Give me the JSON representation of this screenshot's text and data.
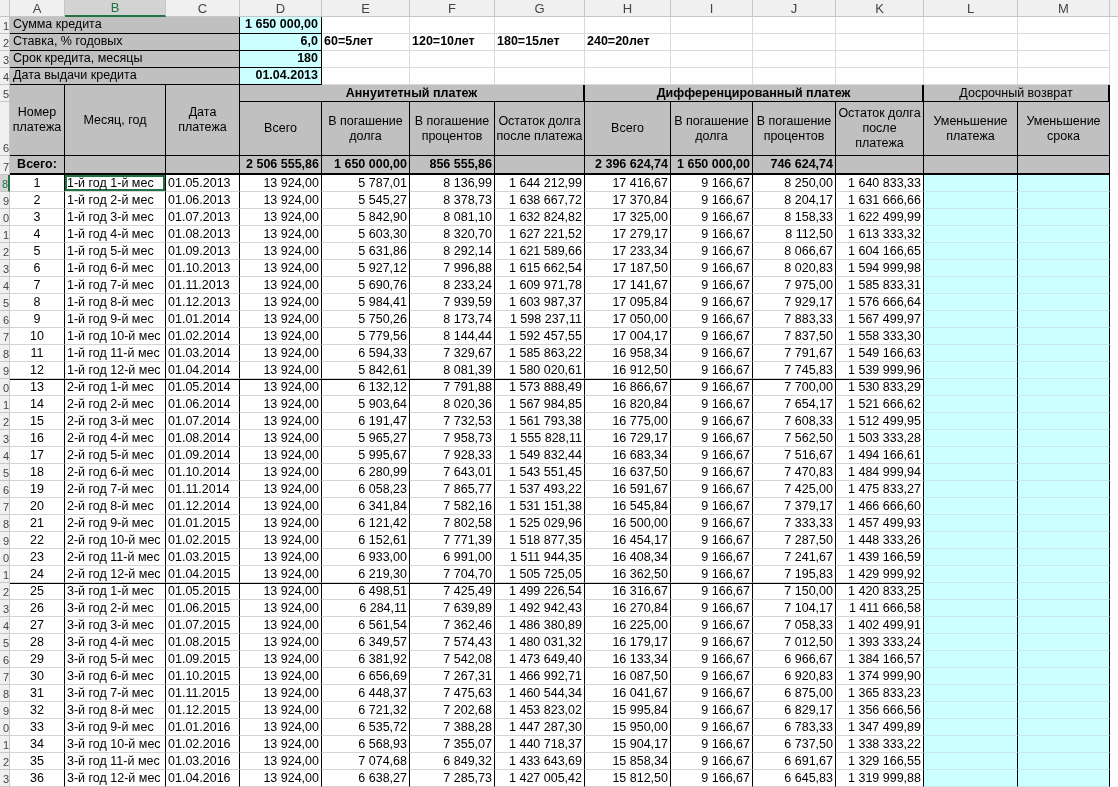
{
  "column_headers": [
    {
      "label": "A",
      "selected": false
    },
    {
      "label": "B",
      "selected": true
    },
    {
      "label": "C",
      "selected": false
    },
    {
      "label": "D",
      "selected": false
    },
    {
      "label": "E",
      "selected": false
    },
    {
      "label": "F",
      "selected": false
    },
    {
      "label": "G",
      "selected": false
    },
    {
      "label": "H",
      "selected": false
    },
    {
      "label": "I",
      "selected": false
    },
    {
      "label": "J",
      "selected": false
    },
    {
      "label": "K",
      "selected": false
    },
    {
      "label": "L",
      "selected": false
    },
    {
      "label": "M",
      "selected": false
    }
  ],
  "summary": [
    {
      "row_number": "1",
      "label": "Сумма кредита",
      "value": "1 650 000,00"
    },
    {
      "row_number": "2",
      "label": "Ставка, % годовых",
      "value": "6,0"
    },
    {
      "row_number": "3",
      "label": "Срок кредита, месяцы",
      "value": "180"
    },
    {
      "row_number": "4",
      "label": "Дата выдачи кредита",
      "value": "01.04.2013"
    }
  ],
  "term_notes": [
    "60=5лет",
    "120=10лет",
    "180=15лет",
    "240=20лет"
  ],
  "table": {
    "header_row_numbers": [
      "5",
      "6",
      "7"
    ],
    "fixed_columns": [
      "Номер платежа",
      "Месяц, год",
      "Дата платежа"
    ],
    "totals_label": "Всего:",
    "groups": [
      {
        "title": "Аннуитетный платеж",
        "bold": true,
        "kind": "schedule",
        "columns": [
          "Всего",
          "В погашение долга",
          "В погашение процентов",
          "Остаток долга после платежа"
        ],
        "totals": [
          "2 506 555,86",
          "1 650 000,00",
          "856 555,86"
        ]
      },
      {
        "title": "Дифференцированный платеж",
        "bold": true,
        "kind": "schedule",
        "columns": [
          "Всего",
          "В погашение долга",
          "В погашение процентов",
          "Остаток долга после платежа"
        ],
        "totals": [
          "2 396 624,74",
          "1 650 000,00",
          "746 624,74"
        ]
      },
      {
        "title": "Досрочный возврат",
        "bold": false,
        "kind": "input",
        "columns": [
          "Уменьшение платежа",
          "Уменьшение срока"
        ]
      }
    ],
    "rows": [
      {
        "row_number": "8",
        "selected": true,
        "year_start": false,
        "cells": [
          "1",
          "1-й год 1-й мес",
          "01.05.2013",
          "13 924,00",
          "5 787,01",
          "8 136,99",
          "1 644 212,99",
          "17 416,67",
          "9 166,67",
          "8 250,00",
          "1 640 833,33"
        ]
      },
      {
        "row_number": "9",
        "selected": false,
        "year_start": false,
        "cells": [
          "2",
          "1-й год 2-й мес",
          "01.06.2013",
          "13 924,00",
          "5 545,27",
          "8 378,73",
          "1 638 667,72",
          "17 370,84",
          "9 166,67",
          "8 204,17",
          "1 631 666,66"
        ]
      },
      {
        "row_number": "0",
        "selected": false,
        "year_start": false,
        "cells": [
          "3",
          "1-й год 3-й мес",
          "01.07.2013",
          "13 924,00",
          "5 842,90",
          "8 081,10",
          "1 632 824,82",
          "17 325,00",
          "9 166,67",
          "8 158,33",
          "1 622 499,99"
        ]
      },
      {
        "row_number": "1",
        "selected": false,
        "year_start": false,
        "cells": [
          "4",
          "1-й год 4-й мес",
          "01.08.2013",
          "13 924,00",
          "5 603,30",
          "8 320,70",
          "1 627 221,52",
          "17 279,17",
          "9 166,67",
          "8 112,50",
          "1 613 333,32"
        ]
      },
      {
        "row_number": "2",
        "selected": false,
        "year_start": false,
        "cells": [
          "5",
          "1-й год 5-й мес",
          "01.09.2013",
          "13 924,00",
          "5 631,86",
          "8 292,14",
          "1 621 589,66",
          "17 233,34",
          "9 166,67",
          "8 066,67",
          "1 604 166,65"
        ]
      },
      {
        "row_number": "3",
        "selected": false,
        "year_start": false,
        "cells": [
          "6",
          "1-й год 6-й мес",
          "01.10.2013",
          "13 924,00",
          "5 927,12",
          "7 996,88",
          "1 615 662,54",
          "17 187,50",
          "9 166,67",
          "8 020,83",
          "1 594 999,98"
        ]
      },
      {
        "row_number": "4",
        "selected": false,
        "year_start": false,
        "cells": [
          "7",
          "1-й год 7-й мес",
          "01.11.2013",
          "13 924,00",
          "5 690,76",
          "8 233,24",
          "1 609 971,78",
          "17 141,67",
          "9 166,67",
          "7 975,00",
          "1 585 833,31"
        ]
      },
      {
        "row_number": "5",
        "selected": false,
        "year_start": false,
        "cells": [
          "8",
          "1-й год 8-й мес",
          "01.12.2013",
          "13 924,00",
          "5 984,41",
          "7 939,59",
          "1 603 987,37",
          "17 095,84",
          "9 166,67",
          "7 929,17",
          "1 576 666,64"
        ]
      },
      {
        "row_number": "6",
        "selected": false,
        "year_start": false,
        "cells": [
          "9",
          "1-й год 9-й мес",
          "01.01.2014",
          "13 924,00",
          "5 750,26",
          "8 173,74",
          "1 598 237,11",
          "17 050,00",
          "9 166,67",
          "7 883,33",
          "1 567 499,97"
        ]
      },
      {
        "row_number": "7",
        "selected": false,
        "year_start": false,
        "cells": [
          "10",
          "1-й год 10-й мес",
          "01.02.2014",
          "13 924,00",
          "5 779,56",
          "8 144,44",
          "1 592 457,55",
          "17 004,17",
          "9 166,67",
          "7 837,50",
          "1 558 333,30"
        ]
      },
      {
        "row_number": "8",
        "selected": false,
        "year_start": false,
        "cells": [
          "11",
          "1-й год 11-й мес",
          "01.03.2014",
          "13 924,00",
          "6 594,33",
          "7 329,67",
          "1 585 863,22",
          "16 958,34",
          "9 166,67",
          "7 791,67",
          "1 549 166,63"
        ]
      },
      {
        "row_number": "9",
        "selected": false,
        "year_start": false,
        "cells": [
          "12",
          "1-й год 12-й мес",
          "01.04.2014",
          "13 924,00",
          "5 842,61",
          "8 081,39",
          "1 580 020,61",
          "16 912,50",
          "9 166,67",
          "7 745,83",
          "1 539 999,96"
        ]
      },
      {
        "row_number": "0",
        "selected": false,
        "year_start": true,
        "cells": [
          "13",
          "2-й год 1-й мес",
          "01.05.2014",
          "13 924,00",
          "6 132,12",
          "7 791,88",
          "1 573 888,49",
          "16 866,67",
          "9 166,67",
          "7 700,00",
          "1 530 833,29"
        ]
      },
      {
        "row_number": "1",
        "selected": false,
        "year_start": false,
        "cells": [
          "14",
          "2-й год 2-й мес",
          "01.06.2014",
          "13 924,00",
          "5 903,64",
          "8 020,36",
          "1 567 984,85",
          "16 820,84",
          "9 166,67",
          "7 654,17",
          "1 521 666,62"
        ]
      },
      {
        "row_number": "2",
        "selected": false,
        "year_start": false,
        "cells": [
          "15",
          "2-й год 3-й мес",
          "01.07.2014",
          "13 924,00",
          "6 191,47",
          "7 732,53",
          "1 561 793,38",
          "16 775,00",
          "9 166,67",
          "7 608,33",
          "1 512 499,95"
        ]
      },
      {
        "row_number": "3",
        "selected": false,
        "year_start": false,
        "cells": [
          "16",
          "2-й год 4-й мес",
          "01.08.2014",
          "13 924,00",
          "5 965,27",
          "7 958,73",
          "1 555 828,11",
          "16 729,17",
          "9 166,67",
          "7 562,50",
          "1 503 333,28"
        ]
      },
      {
        "row_number": "4",
        "selected": false,
        "year_start": false,
        "cells": [
          "17",
          "2-й год 5-й мес",
          "01.09.2014",
          "13 924,00",
          "5 995,67",
          "7 928,33",
          "1 549 832,44",
          "16 683,34",
          "9 166,67",
          "7 516,67",
          "1 494 166,61"
        ]
      },
      {
        "row_number": "5",
        "selected": false,
        "year_start": false,
        "cells": [
          "18",
          "2-й год 6-й мес",
          "01.10.2014",
          "13 924,00",
          "6 280,99",
          "7 643,01",
          "1 543 551,45",
          "16 637,50",
          "9 166,67",
          "7 470,83",
          "1 484 999,94"
        ]
      },
      {
        "row_number": "6",
        "selected": false,
        "year_start": false,
        "cells": [
          "19",
          "2-й год 7-й мес",
          "01.11.2014",
          "13 924,00",
          "6 058,23",
          "7 865,77",
          "1 537 493,22",
          "16 591,67",
          "9 166,67",
          "7 425,00",
          "1 475 833,27"
        ]
      },
      {
        "row_number": "7",
        "selected": false,
        "year_start": false,
        "cells": [
          "20",
          "2-й год 8-й мес",
          "01.12.2014",
          "13 924,00",
          "6 341,84",
          "7 582,16",
          "1 531 151,38",
          "16 545,84",
          "9 166,67",
          "7 379,17",
          "1 466 666,60"
        ]
      },
      {
        "row_number": "8",
        "selected": false,
        "year_start": false,
        "cells": [
          "21",
          "2-й год 9-й мес",
          "01.01.2015",
          "13 924,00",
          "6 121,42",
          "7 802,58",
          "1 525 029,96",
          "16 500,00",
          "9 166,67",
          "7 333,33",
          "1 457 499,93"
        ]
      },
      {
        "row_number": "9",
        "selected": false,
        "year_start": false,
        "cells": [
          "22",
          "2-й год 10-й мес",
          "01.02.2015",
          "13 924,00",
          "6 152,61",
          "7 771,39",
          "1 518 877,35",
          "16 454,17",
          "9 166,67",
          "7 287,50",
          "1 448 333,26"
        ]
      },
      {
        "row_number": "0",
        "selected": false,
        "year_start": false,
        "cells": [
          "23",
          "2-й год 11-й мес",
          "01.03.2015",
          "13 924,00",
          "6 933,00",
          "6 991,00",
          "1 511 944,35",
          "16 408,34",
          "9 166,67",
          "7 241,67",
          "1 439 166,59"
        ]
      },
      {
        "row_number": "1",
        "selected": false,
        "year_start": false,
        "cells": [
          "24",
          "2-й год 12-й мес",
          "01.04.2015",
          "13 924,00",
          "6 219,30",
          "7 704,70",
          "1 505 725,05",
          "16 362,50",
          "9 166,67",
          "7 195,83",
          "1 429 999,92"
        ]
      },
      {
        "row_number": "2",
        "selected": false,
        "year_start": true,
        "cells": [
          "25",
          "3-й год 1-й мес",
          "01.05.2015",
          "13 924,00",
          "6 498,51",
          "7 425,49",
          "1 499 226,54",
          "16 316,67",
          "9 166,67",
          "7 150,00",
          "1 420 833,25"
        ]
      },
      {
        "row_number": "3",
        "selected": false,
        "year_start": false,
        "cells": [
          "26",
          "3-й год 2-й мес",
          "01.06.2015",
          "13 924,00",
          "6 284,11",
          "7 639,89",
          "1 492 942,43",
          "16 270,84",
          "9 166,67",
          "7 104,17",
          "1 411 666,58"
        ]
      },
      {
        "row_number": "4",
        "selected": false,
        "year_start": false,
        "cells": [
          "27",
          "3-й год 3-й мес",
          "01.07.2015",
          "13 924,00",
          "6 561,54",
          "7 362,46",
          "1 486 380,89",
          "16 225,00",
          "9 166,67",
          "7 058,33",
          "1 402 499,91"
        ]
      },
      {
        "row_number": "5",
        "selected": false,
        "year_start": false,
        "cells": [
          "28",
          "3-й год 4-й мес",
          "01.08.2015",
          "13 924,00",
          "6 349,57",
          "7 574,43",
          "1 480 031,32",
          "16 179,17",
          "9 166,67",
          "7 012,50",
          "1 393 333,24"
        ]
      },
      {
        "row_number": "6",
        "selected": false,
        "year_start": false,
        "cells": [
          "29",
          "3-й год 5-й мес",
          "01.09.2015",
          "13 924,00",
          "6 381,92",
          "7 542,08",
          "1 473 649,40",
          "16 133,34",
          "9 166,67",
          "6 966,67",
          "1 384 166,57"
        ]
      },
      {
        "row_number": "7",
        "selected": false,
        "year_start": false,
        "cells": [
          "30",
          "3-й год 6-й мес",
          "01.10.2015",
          "13 924,00",
          "6 656,69",
          "7 267,31",
          "1 466 992,71",
          "16 087,50",
          "9 166,67",
          "6 920,83",
          "1 374 999,90"
        ]
      },
      {
        "row_number": "8",
        "selected": false,
        "year_start": false,
        "cells": [
          "31",
          "3-й год 7-й мес",
          "01.11.2015",
          "13 924,00",
          "6 448,37",
          "7 475,63",
          "1 460 544,34",
          "16 041,67",
          "9 166,67",
          "6 875,00",
          "1 365 833,23"
        ]
      },
      {
        "row_number": "9",
        "selected": false,
        "year_start": false,
        "cells": [
          "32",
          "3-й год 8-й мес",
          "01.12.2015",
          "13 924,00",
          "6 721,32",
          "7 202,68",
          "1 453 823,02",
          "15 995,84",
          "9 166,67",
          "6 829,17",
          "1 356 666,56"
        ]
      },
      {
        "row_number": "0",
        "selected": false,
        "year_start": false,
        "cells": [
          "33",
          "3-й год 9-й мес",
          "01.01.2016",
          "13 924,00",
          "6 535,72",
          "7 388,28",
          "1 447 287,30",
          "15 950,00",
          "9 166,67",
          "6 783,33",
          "1 347 499,89"
        ]
      },
      {
        "row_number": "1",
        "selected": false,
        "year_start": false,
        "cells": [
          "34",
          "3-й год 10-й мес",
          "01.02.2016",
          "13 924,00",
          "6 568,93",
          "7 355,07",
          "1 440 718,37",
          "15 904,17",
          "9 166,67",
          "6 737,50",
          "1 338 333,22"
        ]
      },
      {
        "row_number": "2",
        "selected": false,
        "year_start": false,
        "cells": [
          "35",
          "3-й год 11-й мес",
          "01.03.2016",
          "13 924,00",
          "7 074,68",
          "6 849,32",
          "1 433 643,69",
          "15 858,34",
          "9 166,67",
          "6 691,67",
          "1 329 166,55"
        ]
      },
      {
        "row_number": "3",
        "selected": false,
        "year_start": false,
        "cells": [
          "36",
          "3-й год 12-й мес",
          "01.04.2016",
          "13 924,00",
          "6 638,27",
          "7 285,73",
          "1 427 005,42",
          "15 812,50",
          "9 166,67",
          "6 645,83",
          "1 319 999,88"
        ]
      }
    ]
  }
}
